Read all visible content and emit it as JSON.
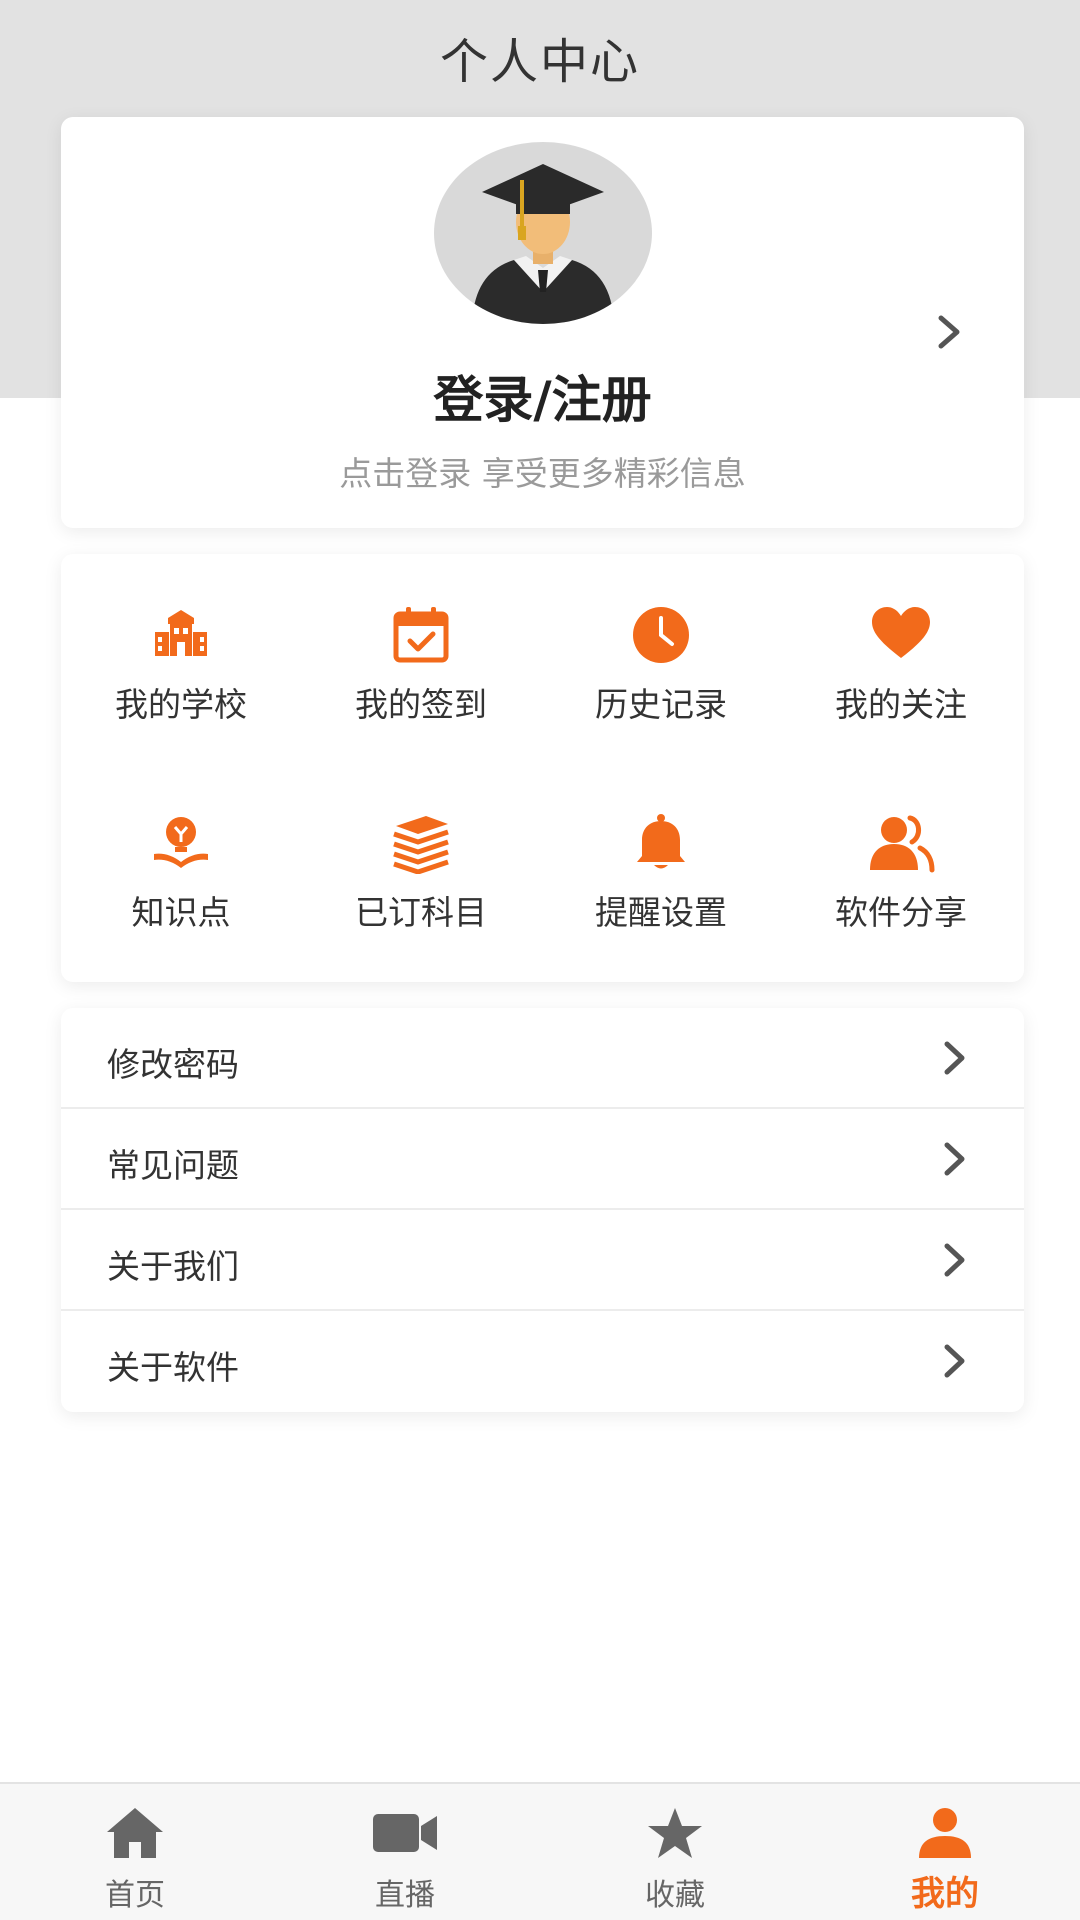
{
  "header": {
    "title": "个人中心"
  },
  "profile": {
    "login_label": "登录/注册",
    "subtitle": "点击登录 享受更多精彩信息"
  },
  "features": [
    {
      "label": "我的学校",
      "icon": "school-icon"
    },
    {
      "label": "我的签到",
      "icon": "calendar-check-icon"
    },
    {
      "label": "历史记录",
      "icon": "clock-icon"
    },
    {
      "label": "我的关注",
      "icon": "heart-icon"
    },
    {
      "label": "知识点",
      "icon": "lightbulb-book-icon"
    },
    {
      "label": "已订科目",
      "icon": "books-stack-icon"
    },
    {
      "label": "提醒设置",
      "icon": "bell-icon"
    },
    {
      "label": "软件分享",
      "icon": "users-share-icon"
    }
  ],
  "menu": [
    {
      "label": "修改密码"
    },
    {
      "label": "常见问题"
    },
    {
      "label": "关于我们"
    },
    {
      "label": "关于软件"
    }
  ],
  "tabbar": [
    {
      "label": "首页",
      "icon": "home-icon"
    },
    {
      "label": "直播",
      "icon": "video-camera-icon"
    },
    {
      "label": "收藏",
      "icon": "star-icon"
    },
    {
      "label": "我的",
      "icon": "user-icon",
      "active": true
    }
  ],
  "colors": {
    "accent": "#f26a1b",
    "icon_gray": "#666666",
    "header_bg": "#e2e2e2"
  }
}
